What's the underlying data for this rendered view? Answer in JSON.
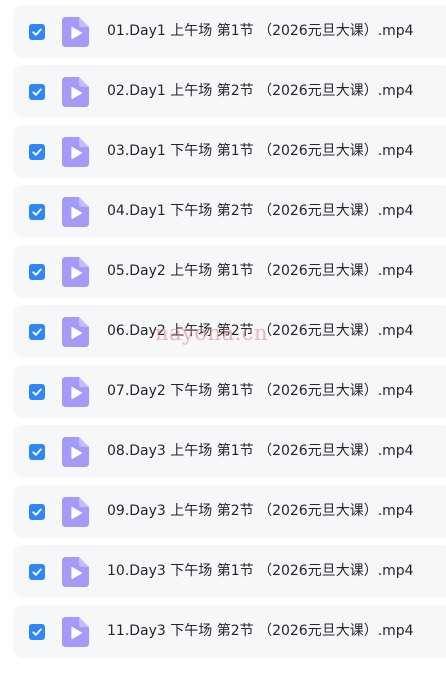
{
  "files": [
    {
      "name": "01.Day1 上午场 第1节 （2026元旦大课）.mp4",
      "checked": true,
      "icon": "video-file-icon"
    },
    {
      "name": "02.Day1 上午场 第2节 （2026元旦大课）.mp4",
      "checked": true,
      "icon": "video-file-icon"
    },
    {
      "name": "03.Day1 下午场 第1节 （2026元旦大课）.mp4",
      "checked": true,
      "icon": "video-file-icon"
    },
    {
      "name": "04.Day1 下午场 第2节 （2026元旦大课）.mp4",
      "checked": true,
      "icon": "video-file-icon"
    },
    {
      "name": "05.Day2 上午场 第1节 （2026元旦大课）.mp4",
      "checked": true,
      "icon": "video-file-icon"
    },
    {
      "name": "06.Day2 上午场 第2节 （2026元旦大课）.mp4",
      "checked": true,
      "icon": "video-file-icon"
    },
    {
      "name": "07.Day2 下午场 第1节 （2026元旦大课）.mp4",
      "checked": true,
      "icon": "video-file-icon"
    },
    {
      "name": "08.Day3 上午场 第1节 （2026元旦大课）.mp4",
      "checked": true,
      "icon": "video-file-icon"
    },
    {
      "name": "09.Day3 上午场 第2节 （2026元旦大课）.mp4",
      "checked": true,
      "icon": "video-file-icon"
    },
    {
      "name": "10.Day3 下午场 第1节 （2026元旦大课）.mp4",
      "checked": true,
      "icon": "video-file-icon"
    },
    {
      "name": "11.Day3 下午场 第2节 （2026元旦大课）.mp4",
      "checked": true,
      "icon": "video-file-icon"
    }
  ],
  "watermark": "nayona.cn",
  "colors": {
    "checkbox": "#2f86f6",
    "file_icon": "#a29bf7",
    "row_background": "#f6f7f9",
    "text": "#23262d",
    "watermark": "#e88080"
  }
}
